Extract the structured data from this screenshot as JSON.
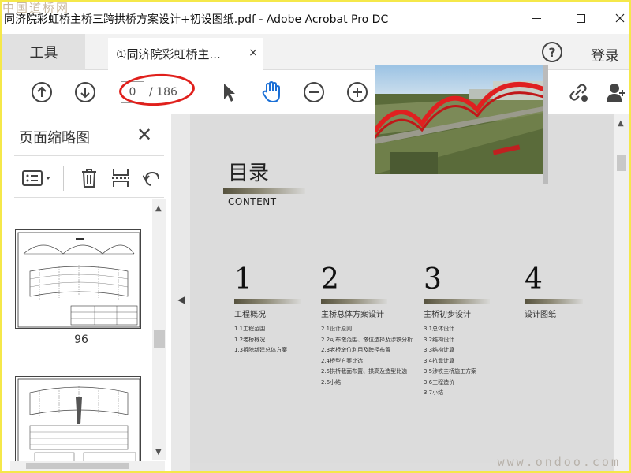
{
  "watermark": {
    "top": "中国道桥网",
    "bottom": "www.ondoo.com"
  },
  "window": {
    "title": "同济院彩虹桥主桥三跨拱桥方案设计+初设图纸.pdf - Adobe Acrobat Pro DC",
    "controls": [
      "minimize",
      "maximize",
      "close"
    ]
  },
  "tabs": {
    "tools_label": "工具",
    "doc_label": "①同济院彩虹桥主...",
    "close_glyph": "×",
    "help_glyph": "?",
    "login_label": "登录"
  },
  "toolbar": {
    "prev_page_icon": "arrow-up-circle-icon",
    "next_page_icon": "arrow-down-circle-icon",
    "page_current": "0",
    "page_total": "/ 186",
    "select_icon": "pointer-icon",
    "hand_icon": "hand-icon",
    "zoom_out_icon": "minus-circle-icon",
    "zoom_in_icon": "plus-circle-icon",
    "annotation_color": "#e0201c"
  },
  "thumbnails": {
    "header": "页面缩略图",
    "close_glyph": "✕",
    "pages": [
      {
        "label": "96"
      },
      {
        "label": ""
      }
    ]
  },
  "document": {
    "title": "目录",
    "subtitle": "CONTENT",
    "sections": [
      {
        "num": "1",
        "title": "工程概况",
        "items": [
          "1.1工程范围",
          "1.2老桥概况",
          "1.3拆除新建总体方案"
        ]
      },
      {
        "num": "2",
        "title": "主桥总体方案设计",
        "items": [
          "2.1设计原则",
          "2.2可布墩范围、墩位选择及涉铁分析",
          "2.3老桥墩位利用及跨径布置",
          "2.4桥型方案比选",
          "2.5拱桥截面布置、拱高及造型比选",
          "2.6小结"
        ]
      },
      {
        "num": "3",
        "title": "主桥初步设计",
        "items": [
          "3.1总体设计",
          "3.2结构设计",
          "3.3结构计算",
          "3.4抗震计算",
          "3.5涉铁主桥施工方案",
          "3.6工程造价",
          "3.7小结"
        ]
      },
      {
        "num": "4",
        "title": "设计图纸",
        "items": []
      }
    ]
  }
}
